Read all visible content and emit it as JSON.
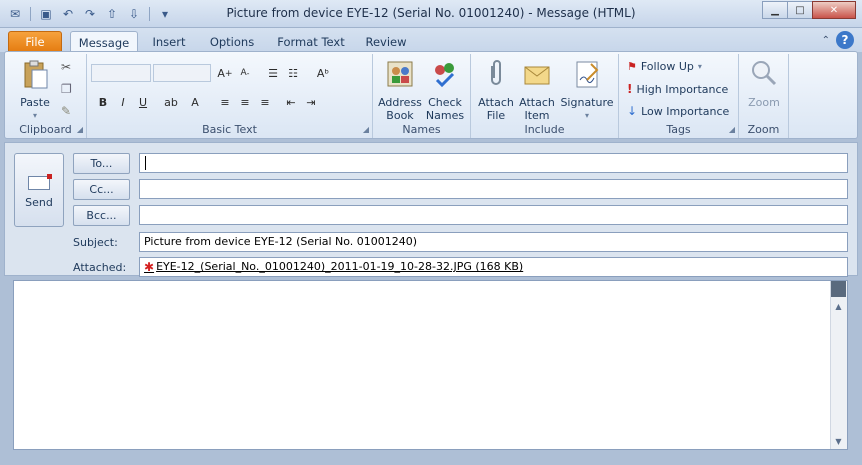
{
  "window": {
    "title": "Picture from device EYE-12 (Serial No. 01001240)  -  Message (HTML)"
  },
  "tabs": [
    "File",
    "Message",
    "Insert",
    "Options",
    "Format Text",
    "Review"
  ],
  "ribbon": {
    "clipboard": {
      "paste": "Paste",
      "label": "Clipboard"
    },
    "basic_text": {
      "label": "Basic Text"
    },
    "names": {
      "address_book": [
        "Address",
        "Book"
      ],
      "check_names": [
        "Check",
        "Names"
      ],
      "label": "Names"
    },
    "include": {
      "attach_file": [
        "Attach",
        "File"
      ],
      "attach_item": [
        "Attach",
        "Item"
      ],
      "signature": "Signature",
      "label": "Include"
    },
    "tags": {
      "follow_up": "Follow Up",
      "high": "High Importance",
      "low": "Low Importance",
      "label": "Tags"
    },
    "zoom": {
      "zoom": "Zoom",
      "label": "Zoom"
    }
  },
  "header": {
    "send": "Send",
    "to": "To...",
    "cc": "Cc...",
    "bcc": "Bcc...",
    "to_value": "",
    "cc_value": "",
    "bcc_value": "",
    "subject_label": "Subject:",
    "subject": "Picture from device EYE-12 (Serial No. 01001240)",
    "attached_label": "Attached:",
    "attachment": "EYE-12_(Serial_No._01001240)_2011-01-19_10-28-32.JPG (168 KB)"
  },
  "colors": {
    "file_tab": "#e57d12",
    "ribbon_bg": "#dbe6f4",
    "high_importance": "#cc2222",
    "low_importance": "#2f6fd0"
  }
}
